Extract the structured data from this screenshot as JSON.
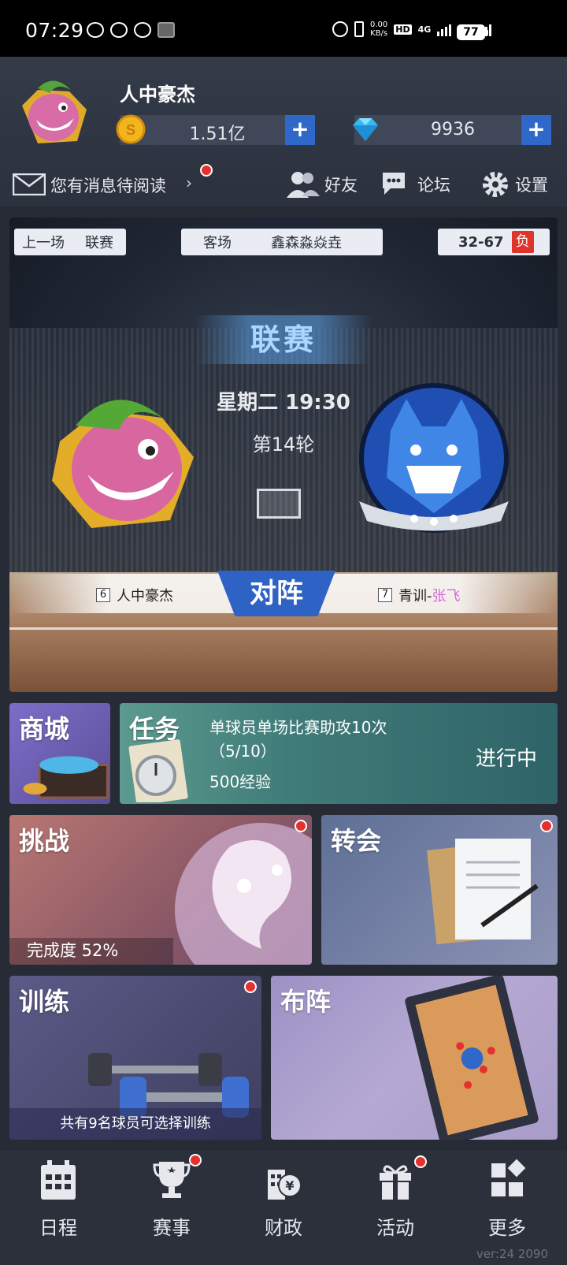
{
  "status_bar": {
    "time": "07:29",
    "net_speed_value": "0.00",
    "net_speed_unit": "KB/s",
    "hd": "HD",
    "net1": "4G",
    "net2": "4G",
    "battery": "77"
  },
  "header": {
    "team_name": "人中豪杰",
    "coins": "1.51亿",
    "gems": "9936",
    "plus": "+",
    "message": "您有消息待阅读",
    "chevron": "›",
    "friends": "好友",
    "forum": "论坛",
    "settings": "设置"
  },
  "match": {
    "last_game_label": "上一场",
    "last_game_type": "联赛",
    "venue": "客场",
    "opponent_last": "鑫森淼焱垚",
    "score": "32-67",
    "result": "负",
    "league": "联赛",
    "time": "星期二 19:30",
    "round": "第14轮",
    "vs": "对阵",
    "home_rank": "6",
    "home_name": "人中豪杰",
    "away_rank": "7",
    "away_name_prefix": "青训-",
    "away_name_suffix": "张飞"
  },
  "tiles": {
    "shop": "商城",
    "task": "任务",
    "task_desc": "单球员单场比赛助攻10次",
    "task_progress": "（5/10）",
    "task_reward": "500经验",
    "task_status": "进行中",
    "challenge": "挑战",
    "challenge_progress": "完成度 52%",
    "transfer": "转会",
    "training": "训练",
    "training_note": "共有9名球员可选择训练",
    "formation": "布阵"
  },
  "nav": [
    {
      "label": "日程",
      "icon": "calendar-icon"
    },
    {
      "label": "赛事",
      "icon": "trophy-icon"
    },
    {
      "label": "财政",
      "icon": "finance-icon"
    },
    {
      "label": "活动",
      "icon": "gift-icon"
    },
    {
      "label": "更多",
      "icon": "more-icon"
    }
  ],
  "version": "ver:24  2090",
  "colors": {
    "accent_blue": "#2f68c9",
    "red_dot": "#e5312b",
    "bg": "#262b36"
  }
}
